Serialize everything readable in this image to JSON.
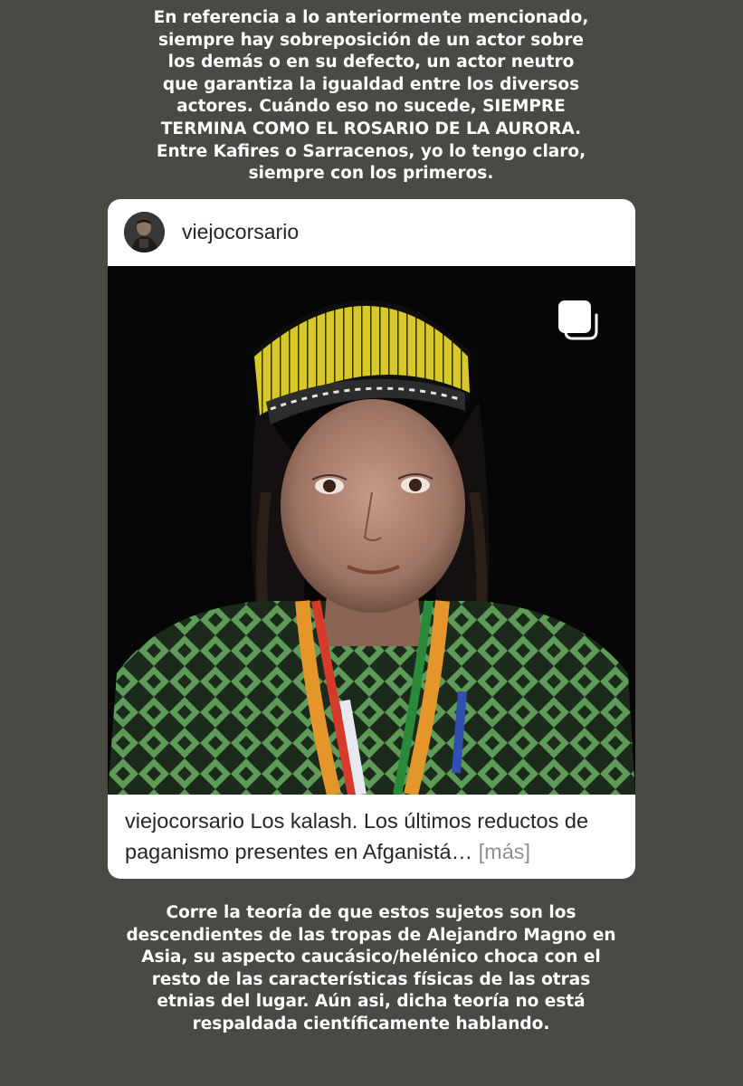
{
  "story": {
    "top_text": "En referencia a lo anteriormente mencionado,\nsiempre hay sobreposición de un actor sobre\nlos demás o en su defecto, un actor neutro\nque garantiza la igualdad entre los diversos\nactores. Cuándo eso no sucede, SIEMPRE\nTERMINA COMO EL ROSARIO DE LA AURORA.\nEntre Kafires o Sarracenos, yo lo tengo claro,\nsiempre con los primeros.",
    "bottom_text": "Corre la teoría de que estos sujetos son los\ndescendientes de las tropas de Alejandro Magno en\nAsia, su aspecto caucásico/helénico choca con el\nresto de las características físicas de las otras\netnias del lugar. Aún asi, dicha teoría no está\nrespaldada científicamente hablando."
  },
  "post": {
    "username": "viejocorsario",
    "caption_user": "viejocorsario",
    "caption_text": " Los kalash. Los últimos reductos de paganismo presentes en Afganistá… ",
    "more_label": "[más]",
    "carousel_icon": "multiple-images-icon",
    "image_subject": "photo"
  },
  "colors": {
    "background": "#4a4a44",
    "card": "#ffffff",
    "text_dark": "#262626",
    "text_muted": "#8e8e8e"
  }
}
